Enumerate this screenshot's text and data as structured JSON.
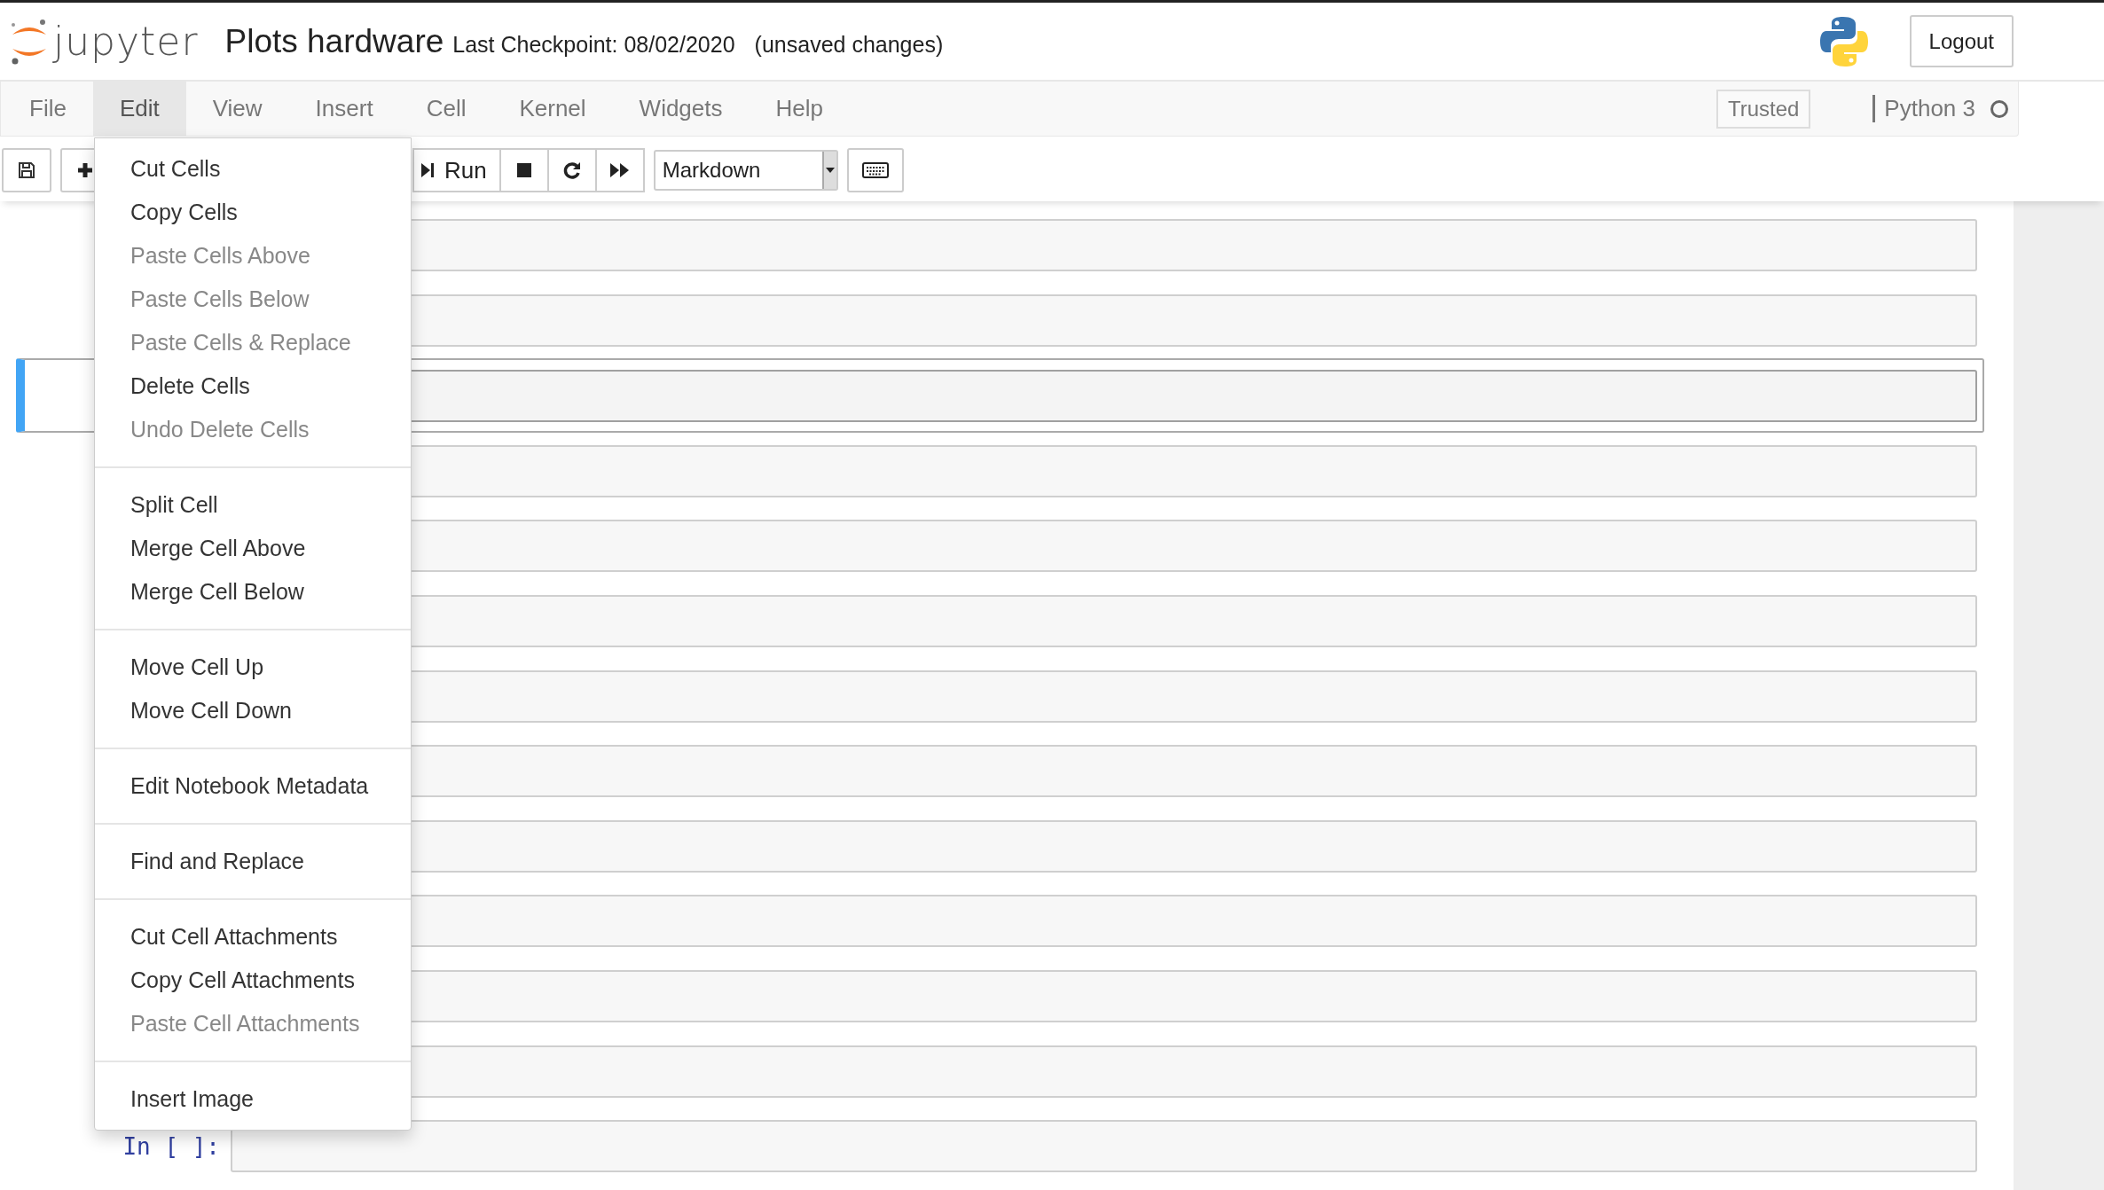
{
  "header": {
    "logo_text": "jupyter",
    "notebook_name": "Plots hardware",
    "checkpoint": "Last Checkpoint: 08/02/2020",
    "autosave_status": "(unsaved changes)",
    "logout": "Logout"
  },
  "menubar": {
    "items": [
      {
        "label": "File",
        "selected": false
      },
      {
        "label": "Edit",
        "selected": true
      },
      {
        "label": "View",
        "selected": false
      },
      {
        "label": "Insert",
        "selected": false
      },
      {
        "label": "Cell",
        "selected": false
      },
      {
        "label": "Kernel",
        "selected": false
      },
      {
        "label": "Widgets",
        "selected": false
      },
      {
        "label": "Help",
        "selected": false
      }
    ],
    "trusted": "Trusted",
    "kernel_name": "Python 3"
  },
  "toolbar": {
    "run_label": "Run",
    "cell_type": "Markdown"
  },
  "edit_menu": {
    "sections": [
      [
        {
          "label": "Cut Cells",
          "disabled": false
        },
        {
          "label": "Copy Cells",
          "disabled": false
        },
        {
          "label": "Paste Cells Above",
          "disabled": true
        },
        {
          "label": "Paste Cells Below",
          "disabled": true
        },
        {
          "label": "Paste Cells & Replace",
          "disabled": true
        },
        {
          "label": "Delete Cells",
          "disabled": false
        },
        {
          "label": "Undo Delete Cells",
          "disabled": true
        }
      ],
      [
        {
          "label": "Split Cell",
          "disabled": false
        },
        {
          "label": "Merge Cell Above",
          "disabled": false
        },
        {
          "label": "Merge Cell Below",
          "disabled": false
        }
      ],
      [
        {
          "label": "Move Cell Up",
          "disabled": false
        },
        {
          "label": "Move Cell Down",
          "disabled": false
        }
      ],
      [
        {
          "label": "Edit Notebook Metadata",
          "disabled": false
        }
      ],
      [
        {
          "label": "Find and Replace",
          "disabled": false
        }
      ],
      [
        {
          "label": "Cut Cell Attachments",
          "disabled": false
        },
        {
          "label": "Copy Cell Attachments",
          "disabled": false
        },
        {
          "label": "Paste Cell Attachments",
          "disabled": true
        }
      ],
      [
        {
          "label": "Insert Image",
          "disabled": false
        }
      ]
    ]
  },
  "cells": [
    {
      "selected": false
    },
    {
      "selected": false
    },
    {
      "selected": true
    },
    {
      "selected": false
    },
    {
      "selected": false
    },
    {
      "selected": false
    },
    {
      "selected": false
    },
    {
      "selected": false
    },
    {
      "selected": false
    },
    {
      "selected": false
    },
    {
      "selected": false
    },
    {
      "selected": false
    },
    {
      "selected": false,
      "prompt": "In [ ]:"
    }
  ]
}
